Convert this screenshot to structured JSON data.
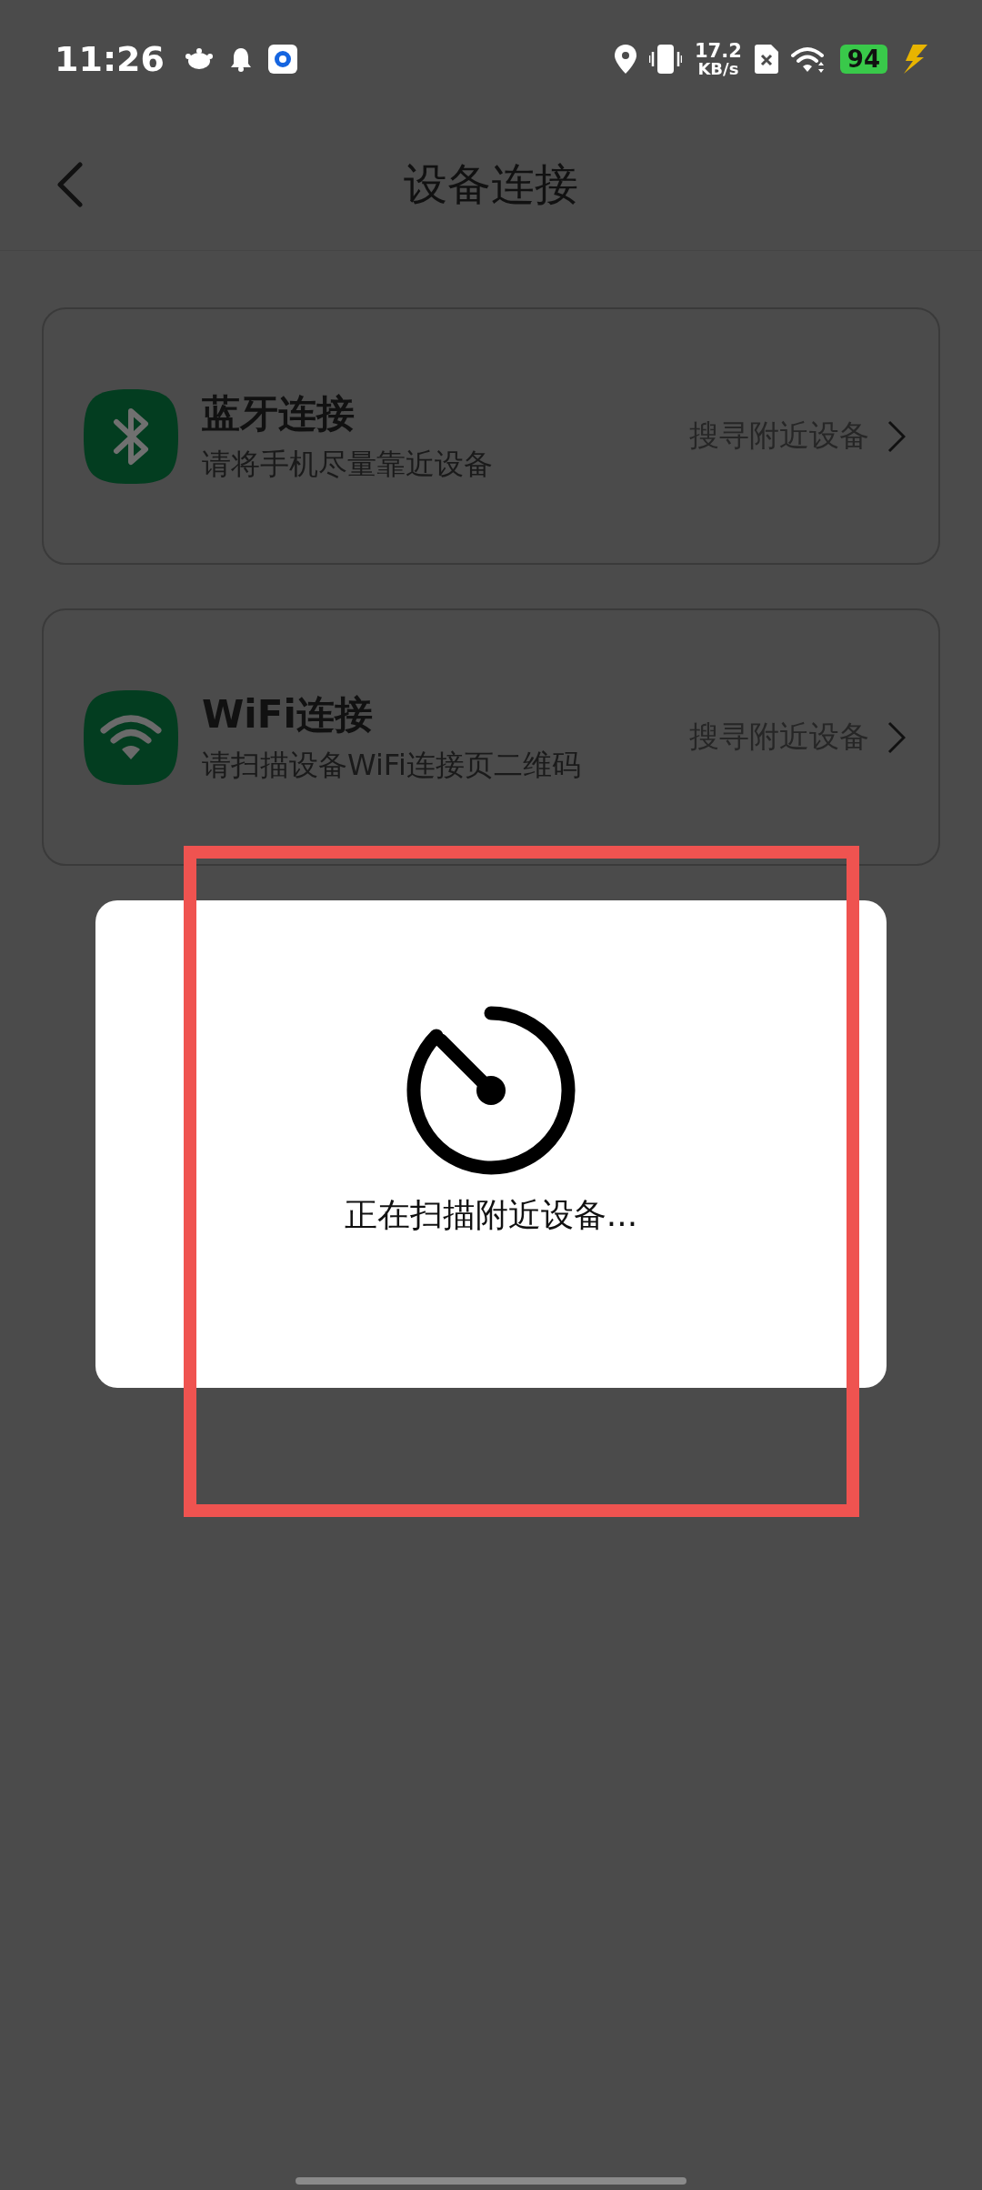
{
  "status_bar": {
    "time": "11:26",
    "net_speed": "17.2",
    "net_unit": "KB/s",
    "battery": "94"
  },
  "header": {
    "title": "设备连接"
  },
  "options": [
    {
      "kind": "bluetooth",
      "title": "蓝牙连接",
      "subtitle": "请将手机尽量靠近设备",
      "action": "搜寻附近设备"
    },
    {
      "kind": "wifi",
      "title": "WiFi连接",
      "subtitle": "请扫描设备WiFi连接页二维码",
      "action": "搜寻附近设备"
    }
  ],
  "dialog": {
    "message": "正在扫描附近设备..."
  }
}
